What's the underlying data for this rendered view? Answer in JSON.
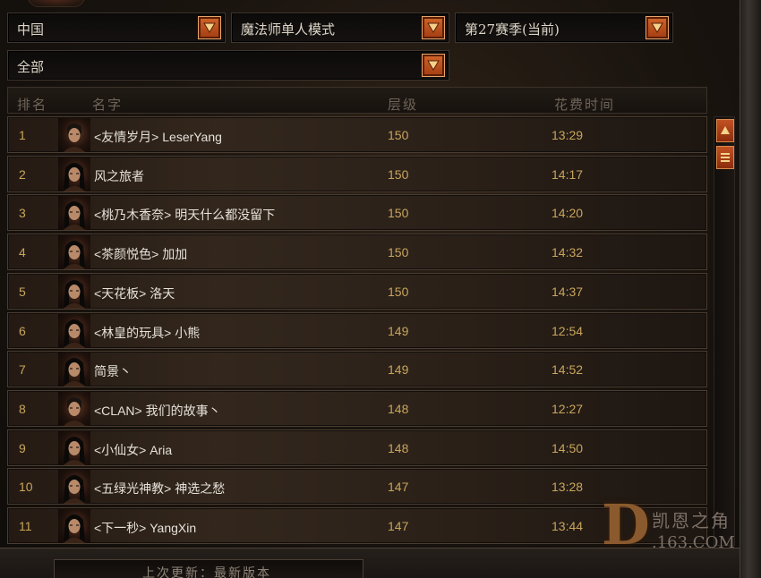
{
  "filters": {
    "region": "中国",
    "mode": "魔法师单人模式",
    "season": "第27赛季(当前)",
    "class_filter": "全部"
  },
  "table": {
    "columns": {
      "rank": "排名",
      "name": "名字",
      "level": "层级",
      "time": "花费时间"
    },
    "rows": [
      {
        "rank": "1",
        "name": "<友情岁月> LeserYang",
        "level": "150",
        "time": "13:29",
        "gender": "male"
      },
      {
        "rank": "2",
        "name": "风之旅者",
        "level": "150",
        "time": "14:17",
        "gender": "female"
      },
      {
        "rank": "3",
        "name": "<桃乃木香奈> 明天什么都没留下",
        "level": "150",
        "time": "14:20",
        "gender": "female"
      },
      {
        "rank": "4",
        "name": "<茶颜悦色> 加加",
        "level": "150",
        "time": "14:32",
        "gender": "female"
      },
      {
        "rank": "5",
        "name": "<天花板> 洛天",
        "level": "150",
        "time": "14:37",
        "gender": "female"
      },
      {
        "rank": "6",
        "name": "<林皇的玩具> 小熊",
        "level": "149",
        "time": "12:54",
        "gender": "female"
      },
      {
        "rank": "7",
        "name": "简景丶",
        "level": "149",
        "time": "14:52",
        "gender": "female"
      },
      {
        "rank": "8",
        "name": "<CLAN> 我们的故事丶",
        "level": "148",
        "time": "12:27",
        "gender": "male"
      },
      {
        "rank": "9",
        "name": "<小仙女> Aria",
        "level": "148",
        "time": "14:50",
        "gender": "female"
      },
      {
        "rank": "10",
        "name": "<五绿光神教> 神选之愁",
        "level": "147",
        "time": "13:28",
        "gender": "female"
      },
      {
        "rank": "11",
        "name": "<下一秒> YangXin",
        "level": "147",
        "time": "13:44",
        "gender": "female"
      }
    ]
  },
  "watermark": {
    "letter": "D",
    "title": "凯恩之角",
    "site": ".163.COM"
  },
  "footer": {
    "update_text": "上次更新：最新版本"
  },
  "icons": {
    "dropdown": "chevron-down-icon",
    "scroll_up": "arrow-up-icon",
    "scroll_menu": "menu-lines-icon",
    "portrait": "wizard-portrait-icon"
  },
  "colors": {
    "accent_orange": "#c25224",
    "gold_text": "#c9a55c",
    "name_text": "#e6e2da",
    "header_text": "#6e6459"
  }
}
